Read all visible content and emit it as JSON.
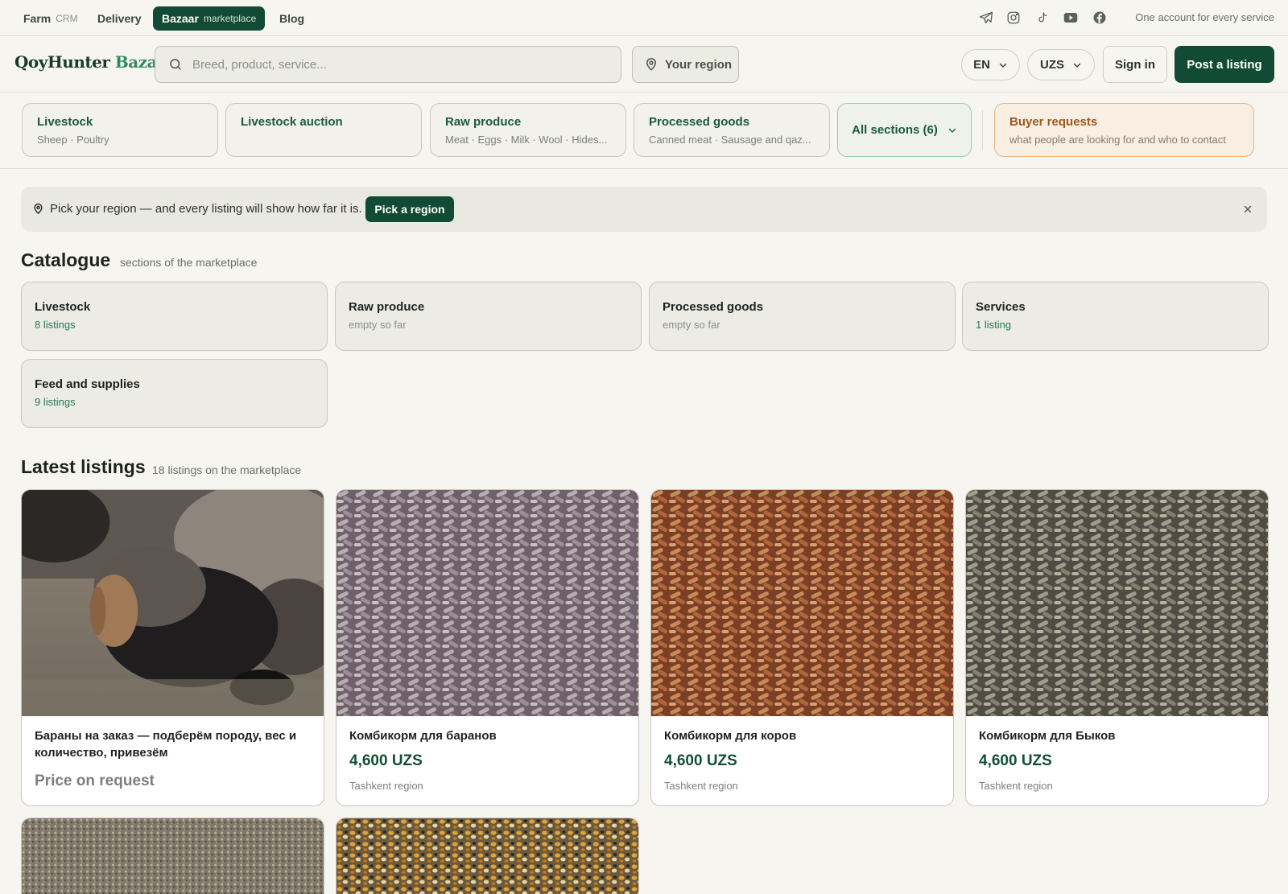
{
  "topnav": {
    "items": [
      {
        "label": "Farm",
        "sub": "CRM"
      },
      {
        "label": "Delivery",
        "sub": ""
      },
      {
        "label": "Bazaar",
        "sub": "marketplace"
      },
      {
        "label": "Blog",
        "sub": ""
      }
    ],
    "active_index": 2,
    "social_icons": [
      "telegram-icon",
      "instagram-icon",
      "tiktok-icon",
      "youtube-icon",
      "facebook-icon"
    ],
    "tagline": "One account for every service"
  },
  "header": {
    "logo_part1": "QoyHunter",
    "logo_part2": "Bazar",
    "search_placeholder": "Breed, product, service...",
    "region_label": "Your region",
    "language": "EN",
    "currency": "UZS",
    "signin_label": "Sign in",
    "post_label": "Post a listing"
  },
  "categories": [
    {
      "title": "Livestock",
      "subtitle": "Sheep · Poultry"
    },
    {
      "title": "Livestock auction",
      "subtitle": ""
    },
    {
      "title": "Raw produce",
      "subtitle": "Meat · Eggs · Milk · Wool · Hides..."
    },
    {
      "title": "Processed goods",
      "subtitle": "Canned meat · Sausage and qaz..."
    }
  ],
  "all_sections_label": "All sections (6)",
  "buyer_requests": {
    "title": "Buyer requests",
    "subtitle": "what people are looking for and who to contact"
  },
  "region_banner": {
    "message": "Pick your region — and every listing will show how far it is.",
    "button": "Pick a region"
  },
  "catalogue": {
    "title": "Catalogue",
    "subtitle": "sections of the marketplace",
    "cards": [
      {
        "title": "Livestock",
        "count": "8 listings"
      },
      {
        "title": "Raw produce",
        "count": "empty so far"
      },
      {
        "title": "Processed goods",
        "count": "empty so far"
      },
      {
        "title": "Services",
        "count": "1 listing"
      },
      {
        "title": "Feed and supplies",
        "count": "9 listings"
      }
    ]
  },
  "latest": {
    "title": "Latest listings",
    "subtitle": "18 listings on the marketplace",
    "listings": [
      {
        "title": "Бараны на заказ — подберём породу, вес и количество, привезём",
        "price": "Price on request",
        "location": ""
      },
      {
        "title": "Комбикорм для баранов",
        "price": "4,600 UZS",
        "location": "Tashkent region"
      },
      {
        "title": "Комбикорм для коров",
        "price": "4,600 UZS",
        "location": "Tashkent region"
      },
      {
        "title": "Комбикорм для Быков",
        "price": "4,600 UZS",
        "location": "Tashkent region"
      }
    ]
  },
  "colors": {
    "brand_green": "#124b35",
    "accent_green": "#2a7a52",
    "buyer_orange": "#9a5b1f",
    "background": "#f6f5ef"
  }
}
